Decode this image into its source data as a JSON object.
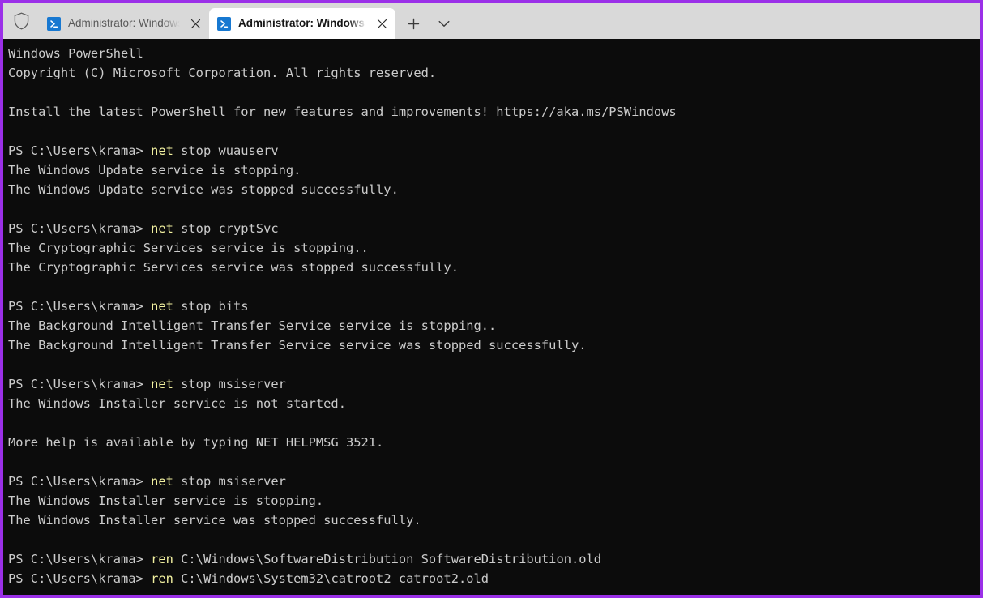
{
  "window": {
    "accent_color": "#9b30e8",
    "terminal_bg": "#0c0c0c",
    "terminal_fg": "#cccccc",
    "command_fg": "#f2f1a0"
  },
  "tabbar": {
    "shield_icon": "shield-icon",
    "new_tab_icon": "plus-icon",
    "dropdown_icon": "chevron-down-icon",
    "close_icon": "close-icon",
    "profile_icon": "powershell-icon",
    "tabs": [
      {
        "title": "Administrator: Windows Powe",
        "active": false
      },
      {
        "title": "Administrator: Windows Powe",
        "active": true
      }
    ]
  },
  "terminal": {
    "lines": [
      {
        "type": "text",
        "text": "Windows PowerShell"
      },
      {
        "type": "text",
        "text": "Copyright (C) Microsoft Corporation. All rights reserved."
      },
      {
        "type": "blank"
      },
      {
        "type": "text",
        "text": "Install the latest PowerShell for new features and improvements! https://aka.ms/PSWindows"
      },
      {
        "type": "blank"
      },
      {
        "type": "prompt",
        "prompt": "PS C:\\Users\\krama> ",
        "cmd": "net",
        "args": " stop wuauserv"
      },
      {
        "type": "text",
        "text": "The Windows Update service is stopping."
      },
      {
        "type": "text",
        "text": "The Windows Update service was stopped successfully."
      },
      {
        "type": "blank"
      },
      {
        "type": "prompt",
        "prompt": "PS C:\\Users\\krama> ",
        "cmd": "net",
        "args": " stop cryptSvc"
      },
      {
        "type": "text",
        "text": "The Cryptographic Services service is stopping.."
      },
      {
        "type": "text",
        "text": "The Cryptographic Services service was stopped successfully."
      },
      {
        "type": "blank"
      },
      {
        "type": "prompt",
        "prompt": "PS C:\\Users\\krama> ",
        "cmd": "net",
        "args": " stop bits"
      },
      {
        "type": "text",
        "text": "The Background Intelligent Transfer Service service is stopping.."
      },
      {
        "type": "text",
        "text": "The Background Intelligent Transfer Service service was stopped successfully."
      },
      {
        "type": "blank"
      },
      {
        "type": "prompt",
        "prompt": "PS C:\\Users\\krama> ",
        "cmd": "net",
        "args": " stop msiserver"
      },
      {
        "type": "text",
        "text": "The Windows Installer service is not started."
      },
      {
        "type": "blank"
      },
      {
        "type": "text",
        "text": "More help is available by typing NET HELPMSG 3521."
      },
      {
        "type": "blank"
      },
      {
        "type": "prompt",
        "prompt": "PS C:\\Users\\krama> ",
        "cmd": "net",
        "args": " stop msiserver"
      },
      {
        "type": "text",
        "text": "The Windows Installer service is stopping."
      },
      {
        "type": "text",
        "text": "The Windows Installer service was stopped successfully."
      },
      {
        "type": "blank"
      },
      {
        "type": "prompt",
        "prompt": "PS C:\\Users\\krama> ",
        "cmd": "ren",
        "args": " C:\\Windows\\SoftwareDistribution SoftwareDistribution.old"
      },
      {
        "type": "prompt",
        "prompt": "PS C:\\Users\\krama> ",
        "cmd": "ren",
        "args": " C:\\Windows\\System32\\catroot2 catroot2.old"
      }
    ]
  }
}
